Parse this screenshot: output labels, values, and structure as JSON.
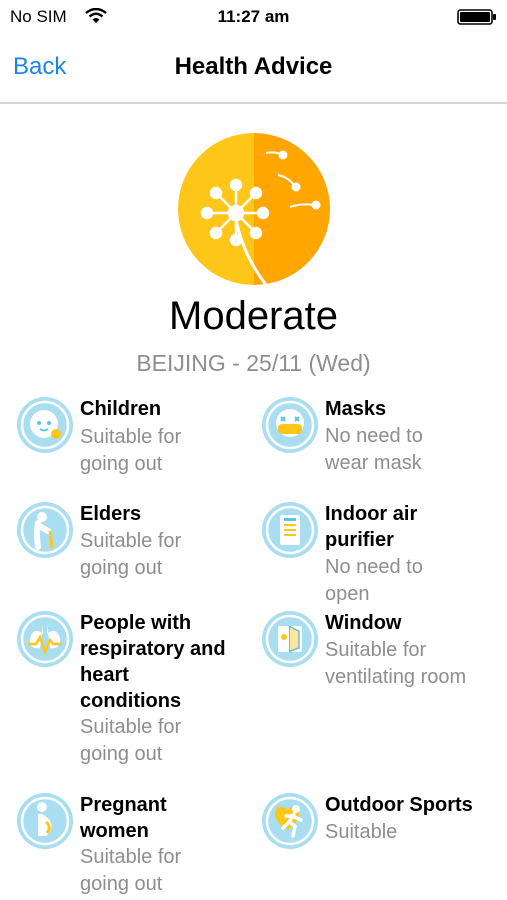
{
  "status_bar": {
    "carrier": "No SIM",
    "time": "11:27 am"
  },
  "nav": {
    "back_label": "Back",
    "title": "Health Advice"
  },
  "summary": {
    "level": "Moderate",
    "location_date": "BEIJING - 25/11 (Wed)"
  },
  "colors": {
    "accent": "#1c86e8",
    "hero_left": "#ffc61a",
    "hero_right": "#ffa600",
    "icon_bg": "#a9ddf0",
    "icon_ring": "#5cc3e6",
    "muted_text": "#8e8e8e"
  },
  "advice": {
    "children": {
      "icon": "baby-face-icon",
      "title": "Children",
      "desc": [
        "Suitable for",
        "going out"
      ]
    },
    "masks": {
      "icon": "mask-icon",
      "title": "Masks",
      "desc": [
        "No need to",
        "wear mask"
      ]
    },
    "elders": {
      "icon": "elder-with-cane-icon",
      "title": "Elders",
      "desc": [
        "Suitable for",
        "going out"
      ]
    },
    "purifier": {
      "icon": "air-purifier-icon",
      "title": [
        "Indoor air",
        "purifier"
      ],
      "desc": [
        "No need to",
        "open"
      ]
    },
    "respiratory": {
      "icon": "lungs-heart-icon",
      "title": [
        "People with",
        "respiratory and",
        "heart",
        "conditions"
      ],
      "desc": [
        "Suitable for",
        "going out"
      ]
    },
    "window": {
      "icon": "window-icon",
      "title": "Window",
      "desc": [
        "Suitable for",
        "ventilating room"
      ]
    },
    "pregnant": {
      "icon": "pregnant-woman-icon",
      "title": [
        "Pregnant",
        "women"
      ],
      "desc": [
        "Suitable for",
        "going out"
      ]
    },
    "sports": {
      "icon": "running-person-icon",
      "title": "Outdoor Sports",
      "desc": [
        "Suitable"
      ]
    }
  }
}
